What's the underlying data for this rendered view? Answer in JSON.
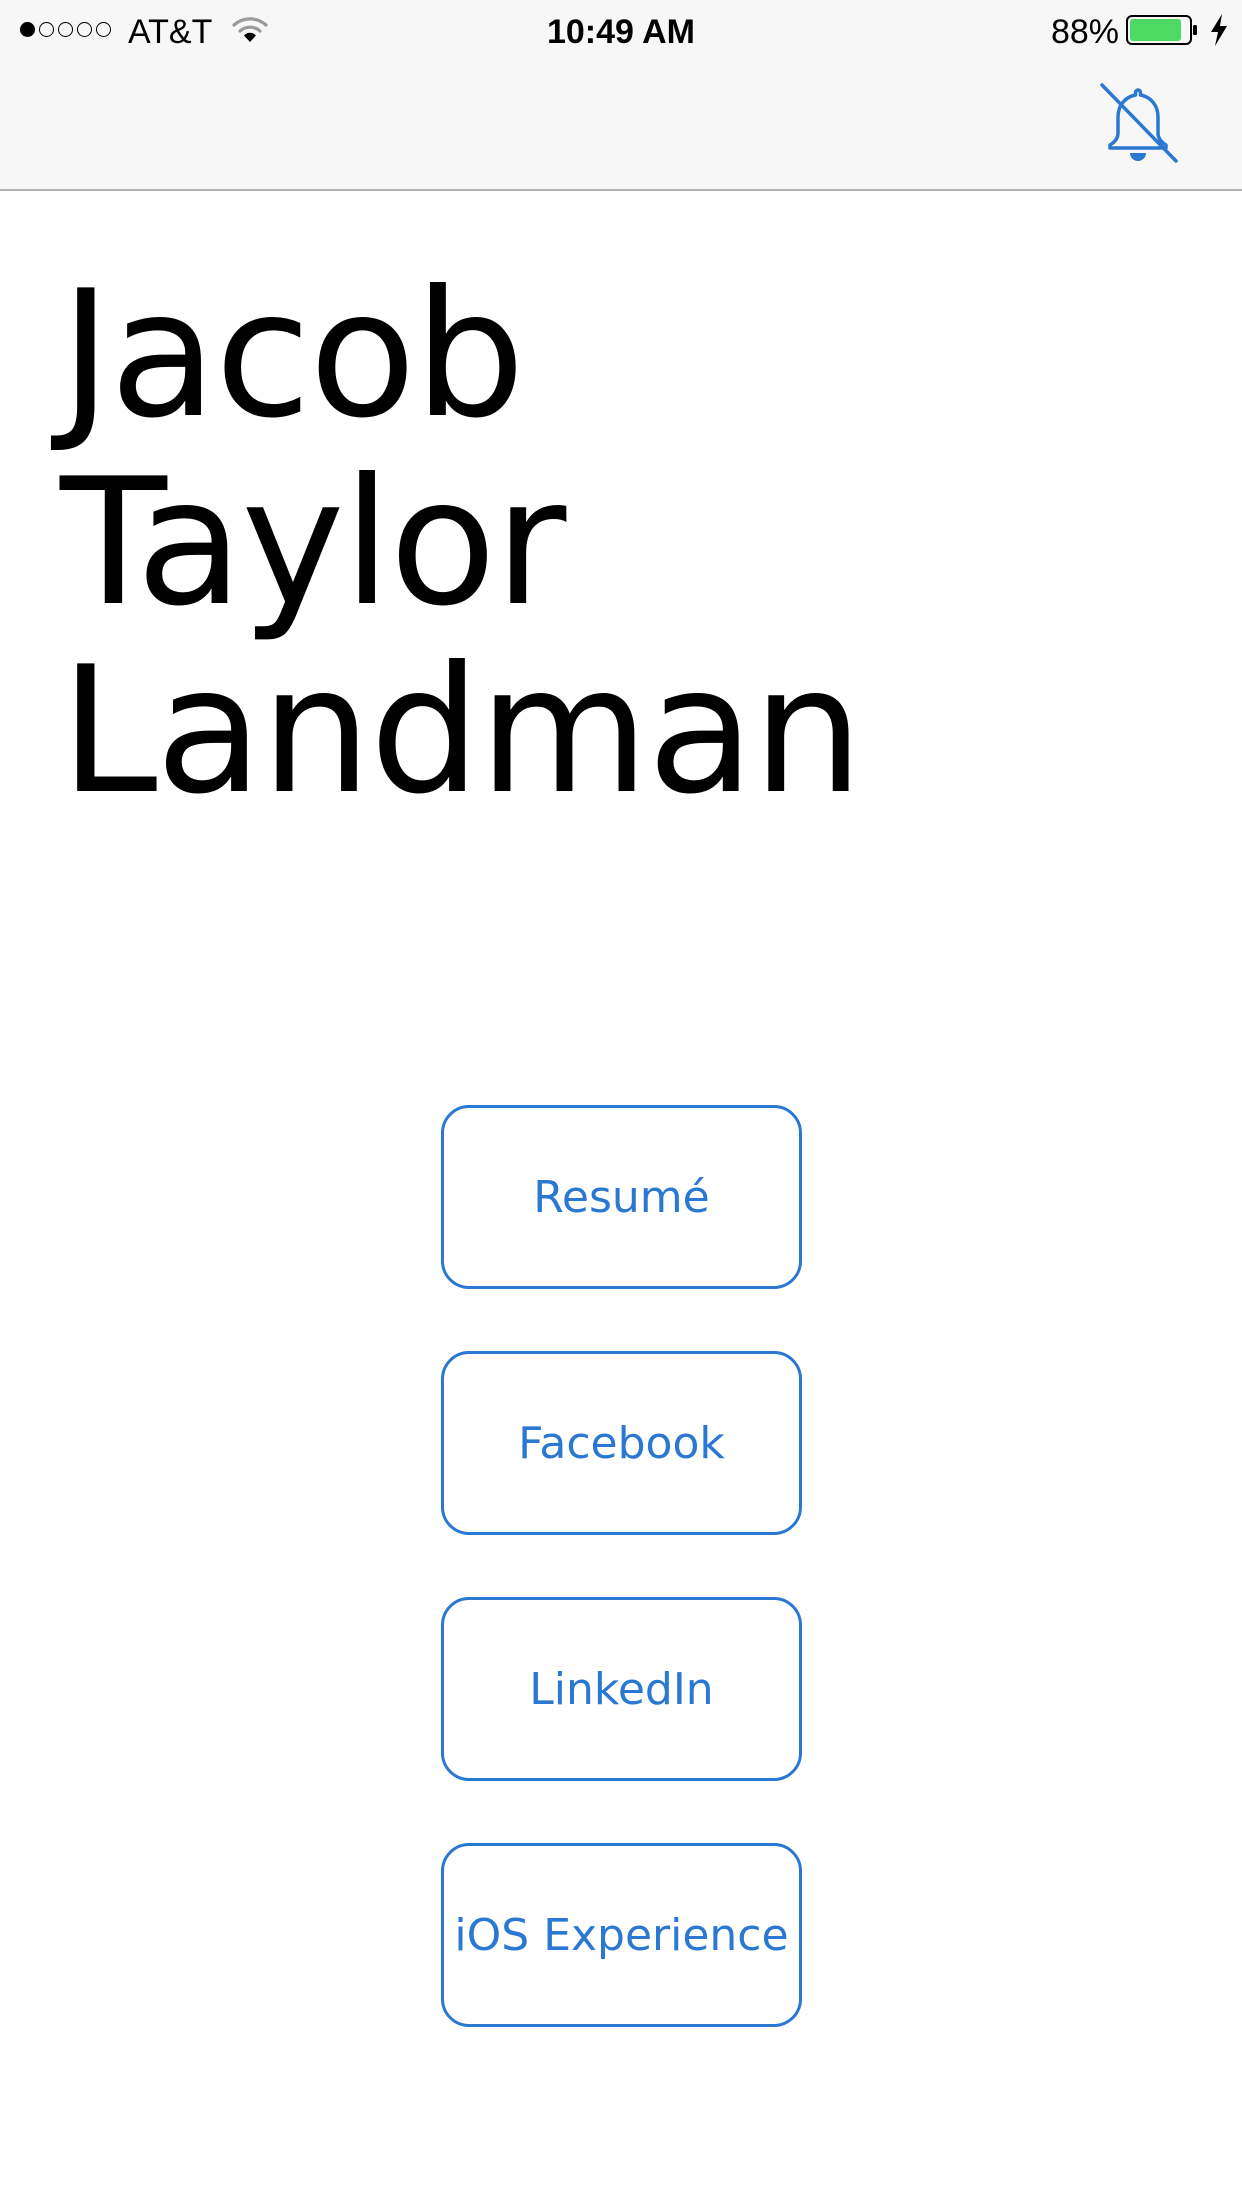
{
  "status_bar": {
    "carrier": "AT&T",
    "signal_bars_filled": 1,
    "signal_bars_total": 5,
    "time": "10:49 AM",
    "battery_percent": "88%",
    "battery_level": 0.88,
    "battery_color": "#4cd964",
    "charging": true,
    "icons": [
      "signal-dots-icon",
      "wifi-icon",
      "battery-icon",
      "charging-bolt-icon"
    ]
  },
  "nav": {
    "right_icon": "bell-slash-icon",
    "tint": "#2a78d2"
  },
  "profile": {
    "name_lines": [
      "Jacob",
      "Taylor",
      "Landman"
    ]
  },
  "buttons": [
    {
      "label": "Resumé"
    },
    {
      "label": "Facebook"
    },
    {
      "label": "LinkedIn"
    },
    {
      "label": "iOS Experience"
    }
  ],
  "colors": {
    "accent": "#2a78d2",
    "bar_background": "#f7f7f7",
    "text": "#000000"
  }
}
